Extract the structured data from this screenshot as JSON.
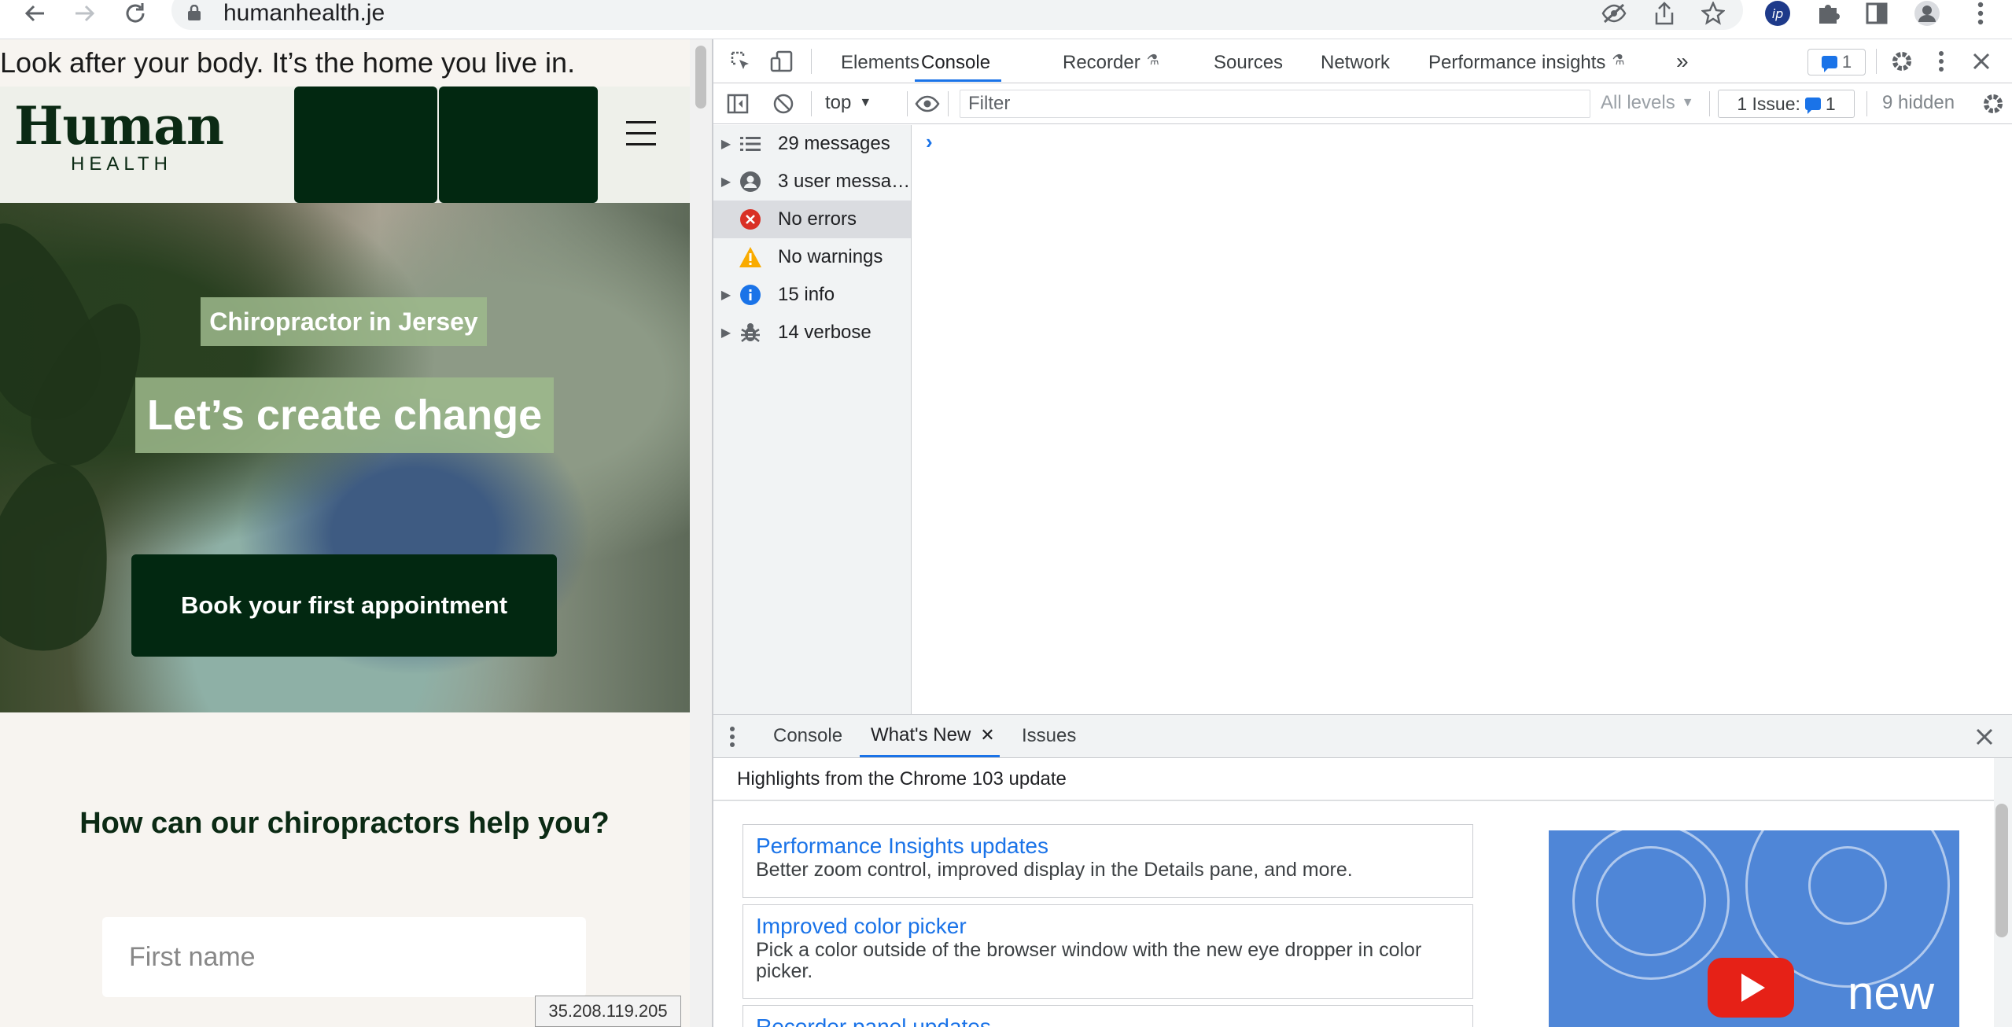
{
  "browser": {
    "url": "humanhealth.je",
    "nav_icons": [
      "back-icon",
      "forward-icon",
      "reload-icon"
    ],
    "toolbar_icons": [
      "eye-off-icon",
      "share-icon",
      "star-icon",
      "ip-icon",
      "puzzle-icon",
      "side-panel-icon",
      "profile-icon",
      "kebab-icon"
    ]
  },
  "site": {
    "tagline": "Look after your body. It’s the home you live in.",
    "logo_word": "Human",
    "logo_sub": "HEALTH",
    "hero_eyebrow": "Chiropractor in Jersey",
    "hero_title": "Let’s create change",
    "cta_label": "Book your first appointment",
    "form_heading": "How can our chiropractors help you?",
    "first_name_placeholder": "First name",
    "ip_address": "35.208.119.205"
  },
  "devtools": {
    "tabs": [
      "Elements",
      "Console",
      "Recorder",
      "Sources",
      "Network",
      "Performance insights"
    ],
    "active_tab": "Console",
    "more_tabs_symbol": "»",
    "issue_badge_count": "1",
    "context": "top",
    "filter_placeholder": "Filter",
    "levels_label": "All levels",
    "issues_label": "1 Issue:",
    "issues_count": "1",
    "hidden_label": "9 hidden",
    "sidebar": [
      {
        "label": "29 messages",
        "icon": "list-icon",
        "expandable": true
      },
      {
        "label": "3 user messages",
        "icon": "user-icon",
        "expandable": true
      },
      {
        "label": "No errors",
        "icon": "error-icon",
        "expandable": false
      },
      {
        "label": "No warnings",
        "icon": "warning-icon",
        "expandable": false
      },
      {
        "label": "15 info",
        "icon": "info-icon",
        "expandable": true
      },
      {
        "label": "14 verbose",
        "icon": "bug-icon",
        "expandable": true
      }
    ],
    "selected_sidebar_item": "No errors",
    "prompt_symbol": "›",
    "drawer": {
      "tabs": [
        "Console",
        "What's New",
        "Issues"
      ],
      "active_tab": "What's New",
      "header": "Highlights from the Chrome 103 update",
      "cards": [
        {
          "title": "Performance Insights updates",
          "description": "Better zoom control, improved display in the Details pane, and more."
        },
        {
          "title": "Improved color picker",
          "description": "Pick a color outside of the browser window with the new eye dropper in color picker."
        },
        {
          "title": "Recorder panel updates",
          "description": ""
        }
      ],
      "video_word": "new"
    }
  },
  "colors": {
    "brand_dark_green": "#022811",
    "devtools_accent": "#1a73e8",
    "error_red": "#d93025",
    "warning_yellow": "#f9ab00",
    "info_blue": "#1a73e8"
  }
}
